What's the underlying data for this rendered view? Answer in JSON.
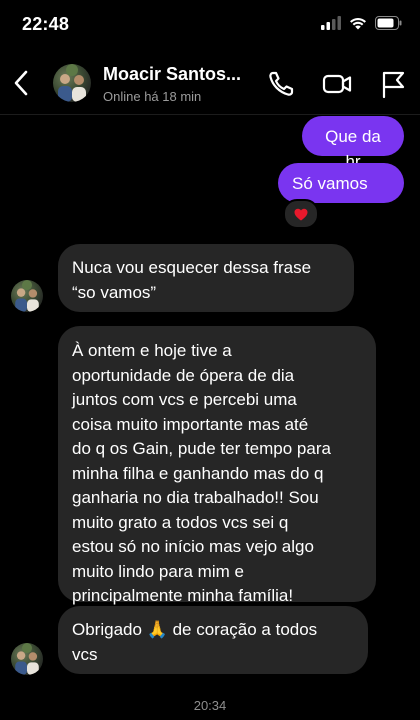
{
  "status_bar": {
    "time": "22:48",
    "icons": [
      "cellular-signal-icon",
      "wifi-icon",
      "battery-icon"
    ]
  },
  "header": {
    "contact_name": "Moacir Santos...",
    "contact_status": "Online há 18 min",
    "actions": [
      "phone-icon",
      "video-camera-icon",
      "flag-icon"
    ]
  },
  "messages": [
    {
      "direction": "out",
      "text": "Que da hr"
    },
    {
      "direction": "out",
      "text": "Só vamos",
      "emoji": "👊",
      "reaction": "❤️"
    },
    {
      "direction": "in",
      "lines": [
        "Nuca vou esquecer dessa frase",
        "“so vamos”"
      ]
    },
    {
      "direction": "in",
      "lines": [
        "À ontem e hoje tive a",
        "oportunidade de ópera de dia",
        "juntos com vcs e percebi uma",
        "coisa muito importante mas até",
        "do q os Gain, pude ter tempo para",
        "minha filha e ganhando mas do q",
        "ganharia no dia trabalhado!! Sou",
        "muito grato a todos vcs sei q",
        "estou só no início mas vejo algo",
        "muito lindo para mim e",
        "principalmente minha família!"
      ]
    },
    {
      "direction": "in",
      "line1_before": "Obrigado",
      "emoji": "🙏",
      "line1_after": "de coração a todos",
      "line2": "vcs"
    }
  ],
  "timestamp": "20:34",
  "colors": {
    "background": "#000000",
    "outgoing_bubble": "#7a35f0",
    "incoming_bubble": "#262626",
    "secondary_text": "#9b9b9b"
  }
}
